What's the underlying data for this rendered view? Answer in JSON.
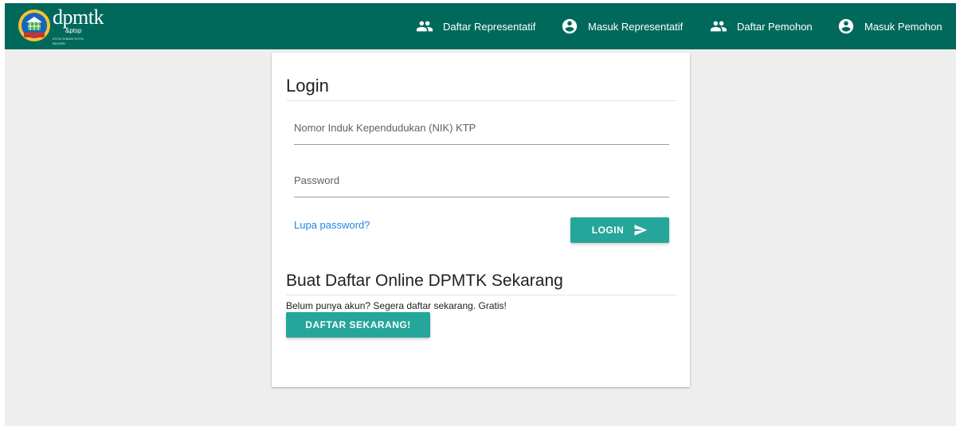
{
  "logo": {
    "wordmark": "dpmtk",
    "sub": "&ptsp",
    "tagline": "KOTA SIMAN KOTA BAHARI"
  },
  "nav": {
    "items": [
      {
        "label": "Daftar Representatif",
        "icon": "people-icon"
      },
      {
        "label": "Masuk Representatif",
        "icon": "account-circle-icon"
      },
      {
        "label": "Daftar Pemohon",
        "icon": "people-icon"
      },
      {
        "label": "Masuk Pemohon",
        "icon": "account-circle-icon"
      }
    ]
  },
  "login": {
    "title": "Login",
    "nik_placeholder": "Nomor Induk Kependudukan (NIK) KTP",
    "password_placeholder": "Password",
    "forgot_label": "Lupa password?",
    "submit_label": "LOGIN",
    "submit_icon": "send-icon"
  },
  "register": {
    "title": "Buat Daftar Online DPMTK Sekarang",
    "text": "Belum punya akun? Segera daftar sekarang. Gratis!",
    "button_label": "DAFTAR SEKARANG!"
  },
  "colors": {
    "navbar": "#00695c",
    "button": "#26a69a",
    "link": "#1e88e5",
    "background": "#eeeeee"
  }
}
